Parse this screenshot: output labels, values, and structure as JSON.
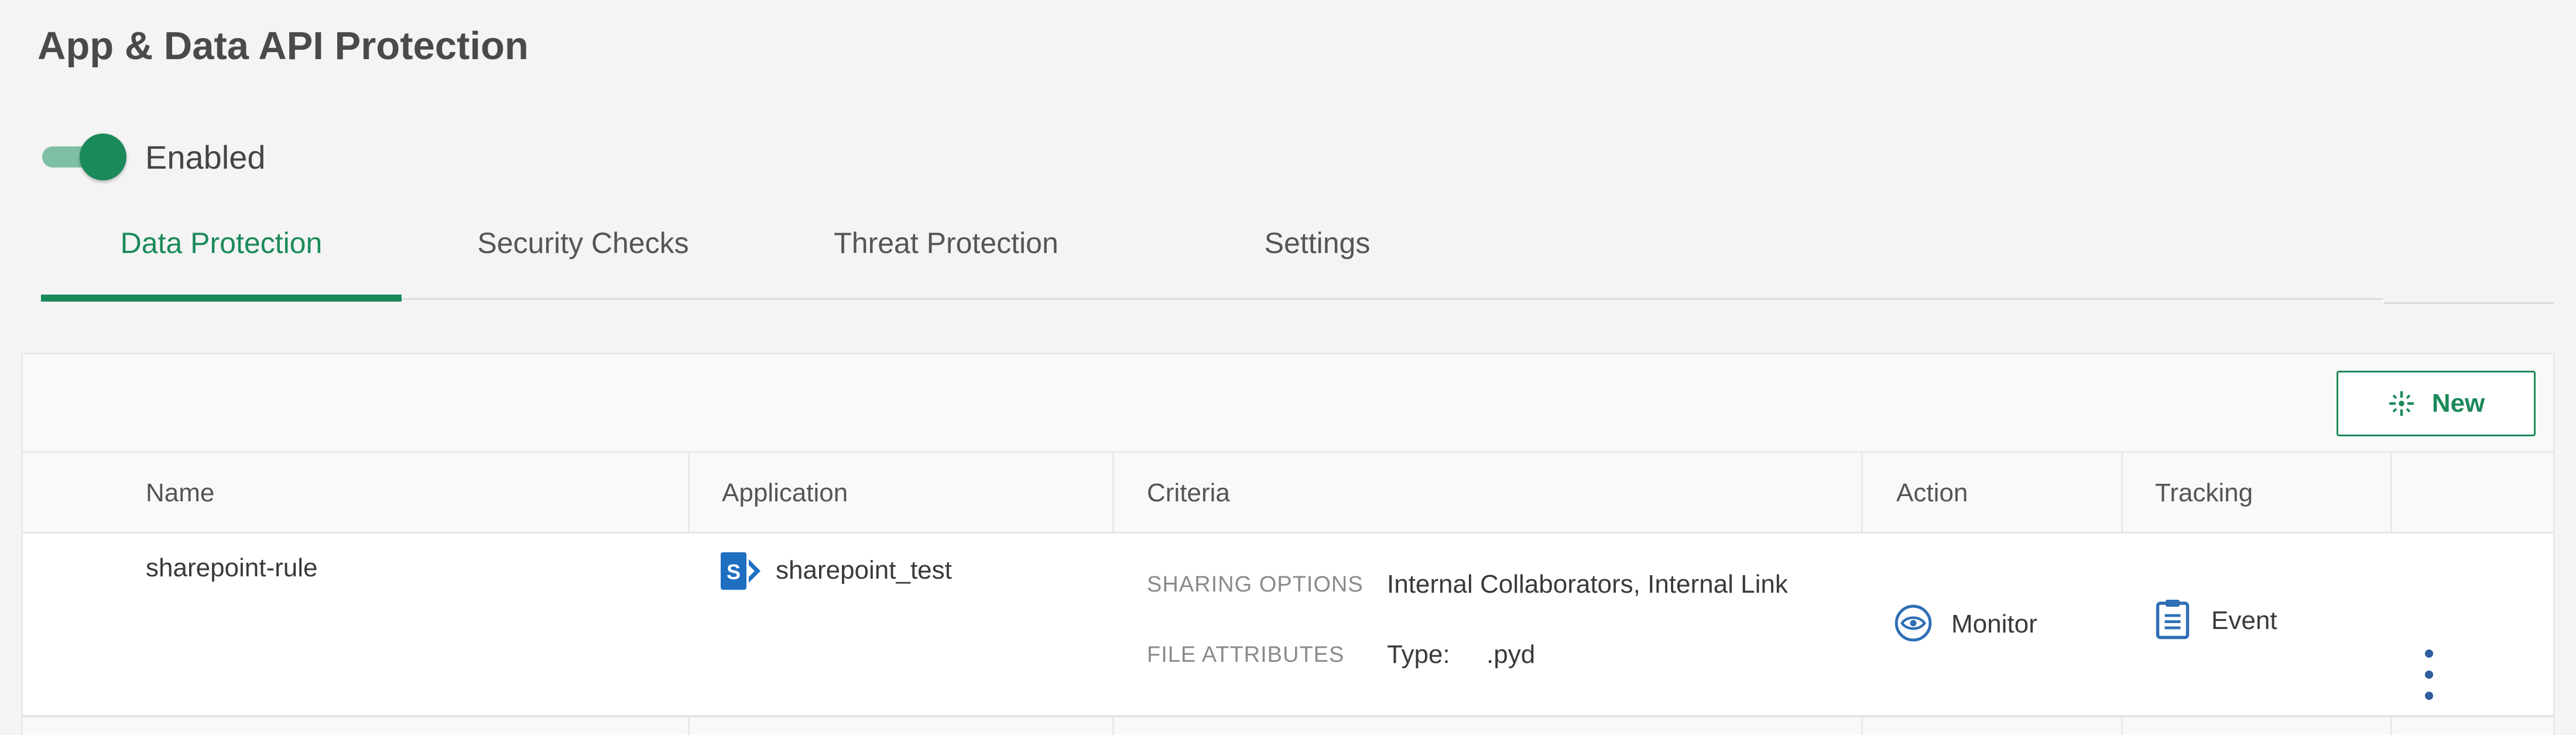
{
  "page": {
    "title": "App & Data API Protection"
  },
  "toggle": {
    "label": "Enabled",
    "state": "on",
    "color": "#1b8a5a"
  },
  "tabs": [
    {
      "label": "Data Protection",
      "active": true
    },
    {
      "label": "Security Checks",
      "active": false
    },
    {
      "label": "Threat Protection",
      "active": false
    },
    {
      "label": "Settings",
      "active": false
    }
  ],
  "toolbar": {
    "new_label": "New"
  },
  "table": {
    "headers": {
      "name": "Name",
      "application": "Application",
      "criteria": "Criteria",
      "action": "Action",
      "tracking": "Tracking"
    },
    "rows": [
      {
        "name": "sharepoint-rule",
        "application": {
          "icon": "sharepoint-icon",
          "label": "sharepoint_test"
        },
        "criteria": {
          "sharing_label": "SHARING OPTIONS",
          "sharing_value": "Internal Collaborators, Internal Link",
          "file_label": "FILE ATTRIBUTES",
          "file_type_key": "Type:",
          "file_type_value": ".pyd"
        },
        "action": {
          "icon": "eye-icon",
          "label": "Monitor"
        },
        "tracking": {
          "icon": "clipboard-icon",
          "label": "Event"
        }
      }
    ]
  },
  "colors": {
    "accent": "#1b8a5a",
    "icon_blue": "#2e6fb5",
    "sharepoint": "#1e6fc0"
  }
}
